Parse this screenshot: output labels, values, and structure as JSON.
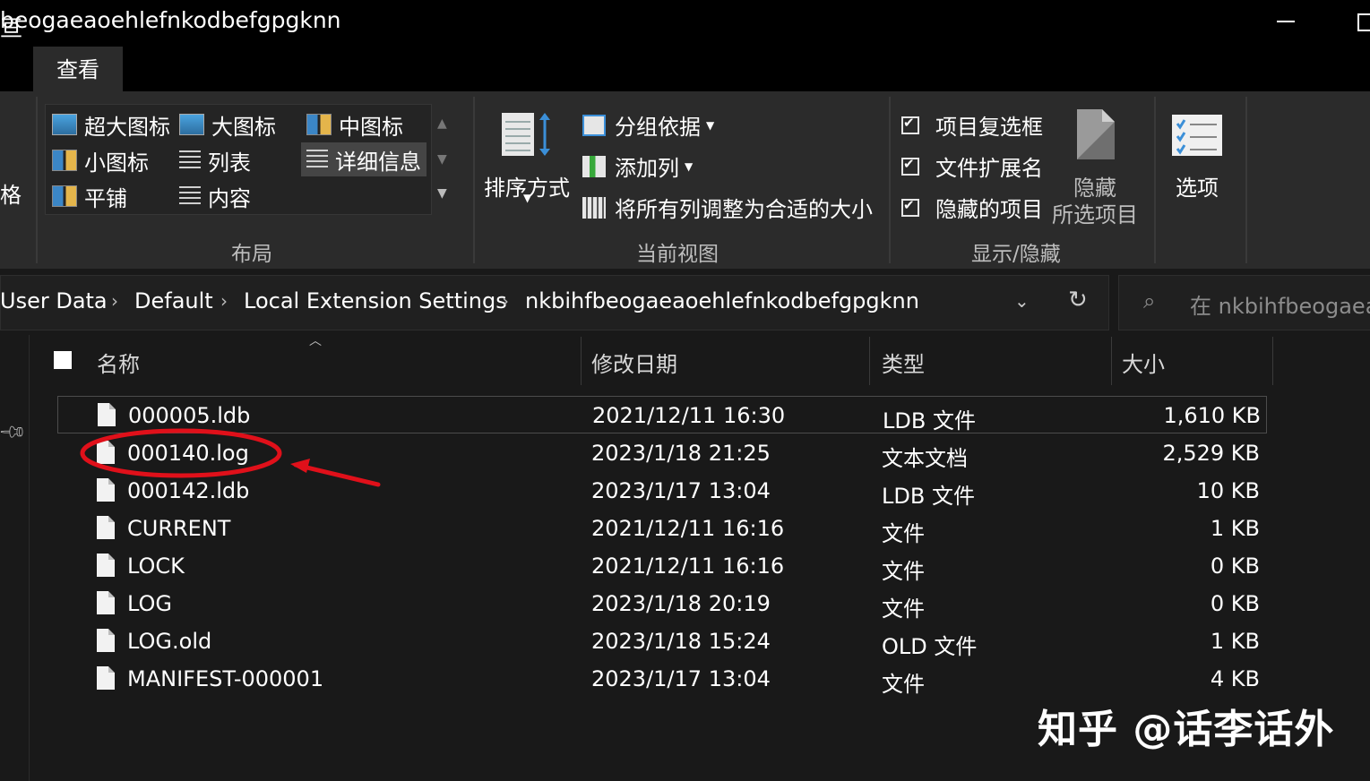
{
  "window": {
    "title": "beogaeaoehlefnkodbefgpgknn"
  },
  "tabs": {
    "prev_partial": "亘",
    "view": "查看"
  },
  "ribbon": {
    "left_partial": "格",
    "layout": {
      "items": [
        "超大图标",
        "大图标",
        "中图标",
        "小图标",
        "列表",
        "详细信息",
        "平铺",
        "内容"
      ],
      "selected": "详细信息",
      "group_label": "布局"
    },
    "current_view": {
      "sort_label": "排序方式",
      "group_by": "分组依据",
      "add_column": "添加列",
      "fit_columns": "将所有列调整为合适的大小",
      "group_label": "当前视图"
    },
    "show_hide": {
      "item_checkboxes": "项目复选框",
      "file_extensions": "文件扩展名",
      "hidden_items": "隐藏的项目",
      "hide_selected_1": "隐藏",
      "hide_selected_2": "所选项目",
      "group_label": "显示/隐藏"
    },
    "options": "选项"
  },
  "address": {
    "crumbs": [
      "User Data",
      "Default",
      "Local Extension Settings",
      "nkbihfbeogaeaoehlefnkodbefgpgknn"
    ],
    "search_placeholder": "在 nkbihfbeogaea"
  },
  "columns": {
    "name": "名称",
    "date": "修改日期",
    "type": "类型",
    "size": "大小"
  },
  "files": [
    {
      "name": "000005.ldb",
      "date": "2021/12/11 16:30",
      "type": "LDB 文件",
      "size": "1,610 KB"
    },
    {
      "name": "000140.log",
      "date": "2023/1/18 21:25",
      "type": "文本文档",
      "size": "2,529 KB"
    },
    {
      "name": "000142.ldb",
      "date": "2023/1/17 13:04",
      "type": "LDB 文件",
      "size": "10 KB"
    },
    {
      "name": "CURRENT",
      "date": "2021/12/11 16:16",
      "type": "文件",
      "size": "1 KB"
    },
    {
      "name": "LOCK",
      "date": "2021/12/11 16:16",
      "type": "文件",
      "size": "0 KB"
    },
    {
      "name": "LOG",
      "date": "2023/1/18 20:19",
      "type": "文件",
      "size": "0 KB"
    },
    {
      "name": "LOG.old",
      "date": "2023/1/18 15:24",
      "type": "OLD 文件",
      "size": "1 KB"
    },
    {
      "name": "MANIFEST-000001",
      "date": "2023/1/17 13:04",
      "type": "文件",
      "size": "4 KB"
    }
  ],
  "watermark": "知乎 @话李话外",
  "annotation_color": "#e0101a"
}
